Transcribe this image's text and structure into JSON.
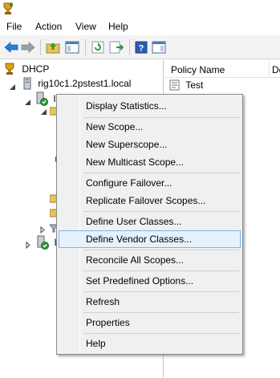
{
  "menubar": {
    "items": [
      "File",
      "Action",
      "View",
      "Help"
    ]
  },
  "toolbar": {
    "buttons": [
      "back-arrow-icon",
      "forward-arrow-icon",
      "up-folder-icon",
      "show-hide-tree-icon",
      "refresh-icon",
      "export-list-icon",
      "help-icon",
      "show-hide-action-pane-icon"
    ]
  },
  "tree": {
    "root_label": "DHCP",
    "server_label": "rig10c1.2pstest1.local",
    "ipv4_label": "IP",
    "ipv6_label": "IP"
  },
  "details": {
    "columns": [
      "Policy Name",
      "De"
    ],
    "rows": [
      {
        "name": "Test"
      }
    ]
  },
  "context_menu": {
    "items": [
      "Display Statistics...",
      "New Scope...",
      "New Superscope...",
      "New Multicast Scope...",
      "Configure Failover...",
      "Replicate Failover Scopes...",
      "Define User Classes...",
      "Define Vendor Classes...",
      "Reconcile All Scopes...",
      "Set Predefined Options...",
      "Refresh",
      "Properties",
      "Help"
    ],
    "highlighted": "Define Vendor Classes..."
  },
  "colors": {
    "toolbar_bg": "#f3f3f3",
    "menu_bg": "#f0f0f0",
    "highlight_bg": "#e5f1fb",
    "highlight_border": "#7eb4ea"
  }
}
